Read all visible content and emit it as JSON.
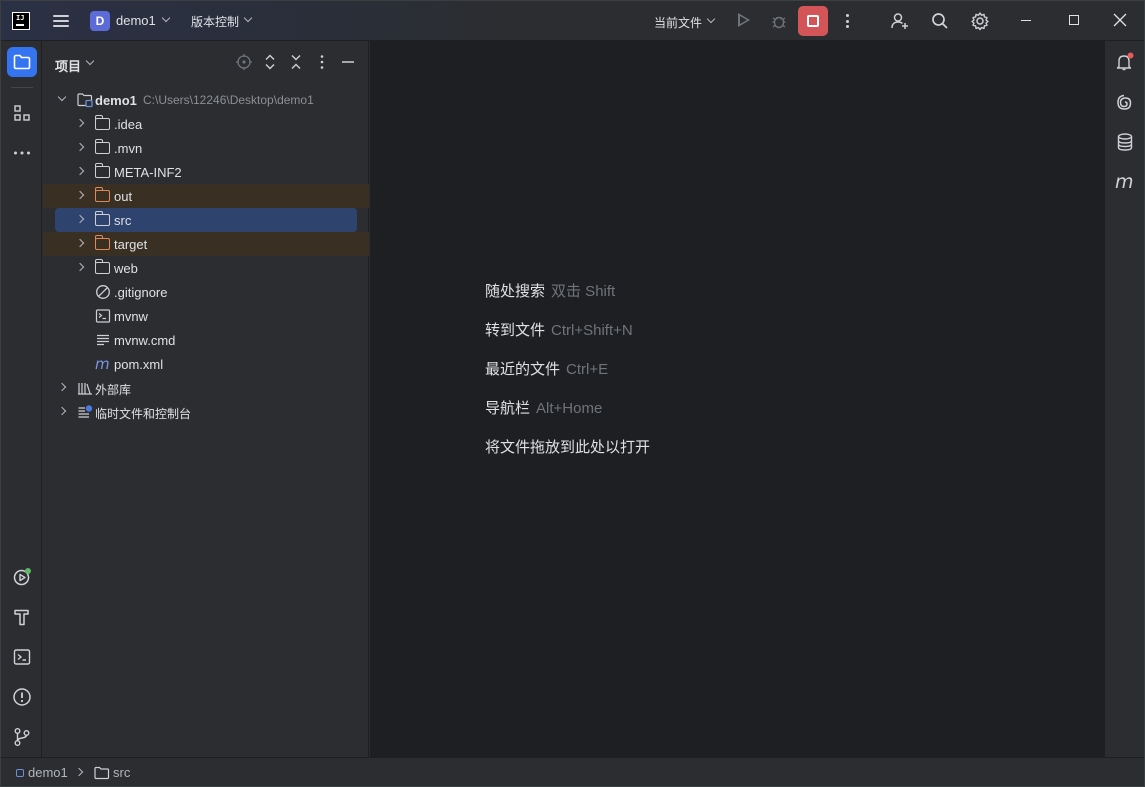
{
  "titlebar": {
    "project_initial": "D",
    "project_name": "demo1",
    "vcs_label": "版本控制",
    "run_config": "当前文件"
  },
  "panel": {
    "title": "项目"
  },
  "tree": {
    "root": {
      "name": "demo1",
      "path": "C:\\Users\\12246\\Desktop\\demo1"
    },
    "items": [
      {
        "label": ".idea"
      },
      {
        "label": ".mvn"
      },
      {
        "label": "META-INF2"
      },
      {
        "label": "out"
      },
      {
        "label": "src"
      },
      {
        "label": "target"
      },
      {
        "label": "web"
      },
      {
        "label": ".gitignore"
      },
      {
        "label": "mvnw"
      },
      {
        "label": "mvnw.cmd"
      },
      {
        "label": "pom.xml"
      }
    ],
    "external_libs": "外部库",
    "scratches": "临时文件和控制台"
  },
  "editor": {
    "hints": [
      {
        "action": "随处搜索",
        "key": "双击 Shift"
      },
      {
        "action": "转到文件",
        "key": "Ctrl+Shift+N"
      },
      {
        "action": "最近的文件",
        "key": "Ctrl+E"
      },
      {
        "action": "导航栏",
        "key": "Alt+Home"
      },
      {
        "action": "将文件拖放到此处以打开",
        "key": ""
      }
    ]
  },
  "statusbar": {
    "module": "demo1",
    "folder": "src"
  },
  "colors": {
    "accent": "#3574f0",
    "stop": "#d35557",
    "excluded_bg": "#3a2f23",
    "selected_bg": "#2e436e",
    "excluded_folder": "#e08855",
    "notification_dot": "#e55b5b",
    "run_dot": "#5fb865"
  }
}
